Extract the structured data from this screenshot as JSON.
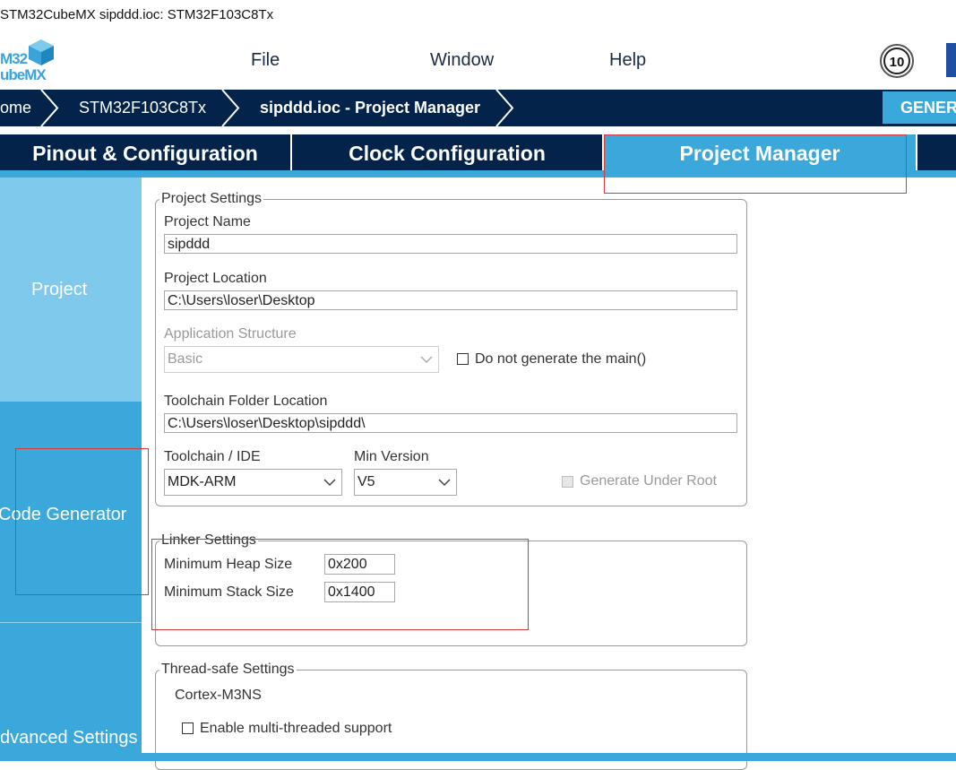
{
  "window": {
    "title": "STM32CubeMX sipddd.ioc: STM32F103C8Tx"
  },
  "logo": {
    "line1": "M32",
    "line2": "ubeMX"
  },
  "menu": {
    "file": "File",
    "window": "Window",
    "help": "Help"
  },
  "breadcrumb": {
    "home": "ome",
    "chip": "STM32F103C8Tx",
    "current": "sipddd.ioc - Project Manager"
  },
  "generate_button": "GENER",
  "tabs": {
    "pinout": "Pinout & Configuration",
    "clock": "Clock Configuration",
    "project_manager": "Project Manager"
  },
  "leftnav": {
    "project": "Project",
    "code_generator": "Code Generator",
    "advanced": "dvanced Settings"
  },
  "project_settings": {
    "legend": "Project Settings",
    "name_label": "Project Name",
    "name_value": "sipddd",
    "location_label": "Project Location",
    "location_value": "C:\\Users\\loser\\Desktop",
    "app_structure_label": "Application Structure",
    "app_structure_value": "Basic",
    "no_main_label": "Do not generate the main()",
    "toolchain_folder_label": "Toolchain Folder Location",
    "toolchain_folder_value": "C:\\Users\\loser\\Desktop\\sipddd\\",
    "toolchain_label": "Toolchain / IDE",
    "toolchain_value": "MDK-ARM",
    "min_version_label": "Min Version",
    "min_version_value": "V5",
    "gen_under_root_label": "Generate Under Root"
  },
  "linker_settings": {
    "legend": "Linker Settings",
    "heap_label": "Minimum Heap Size",
    "heap_value": "0x200",
    "stack_label": "Minimum Stack Size",
    "stack_value": "0x1400"
  },
  "thread_safe_settings": {
    "legend": "Thread-safe Settings",
    "core": "Cortex-M3NS",
    "multithread_label": "Enable multi-threaded support"
  },
  "colors": {
    "dark_navy": "#03234b",
    "accent_blue": "#3aa8db",
    "highlight_red": "#d63a3a"
  }
}
